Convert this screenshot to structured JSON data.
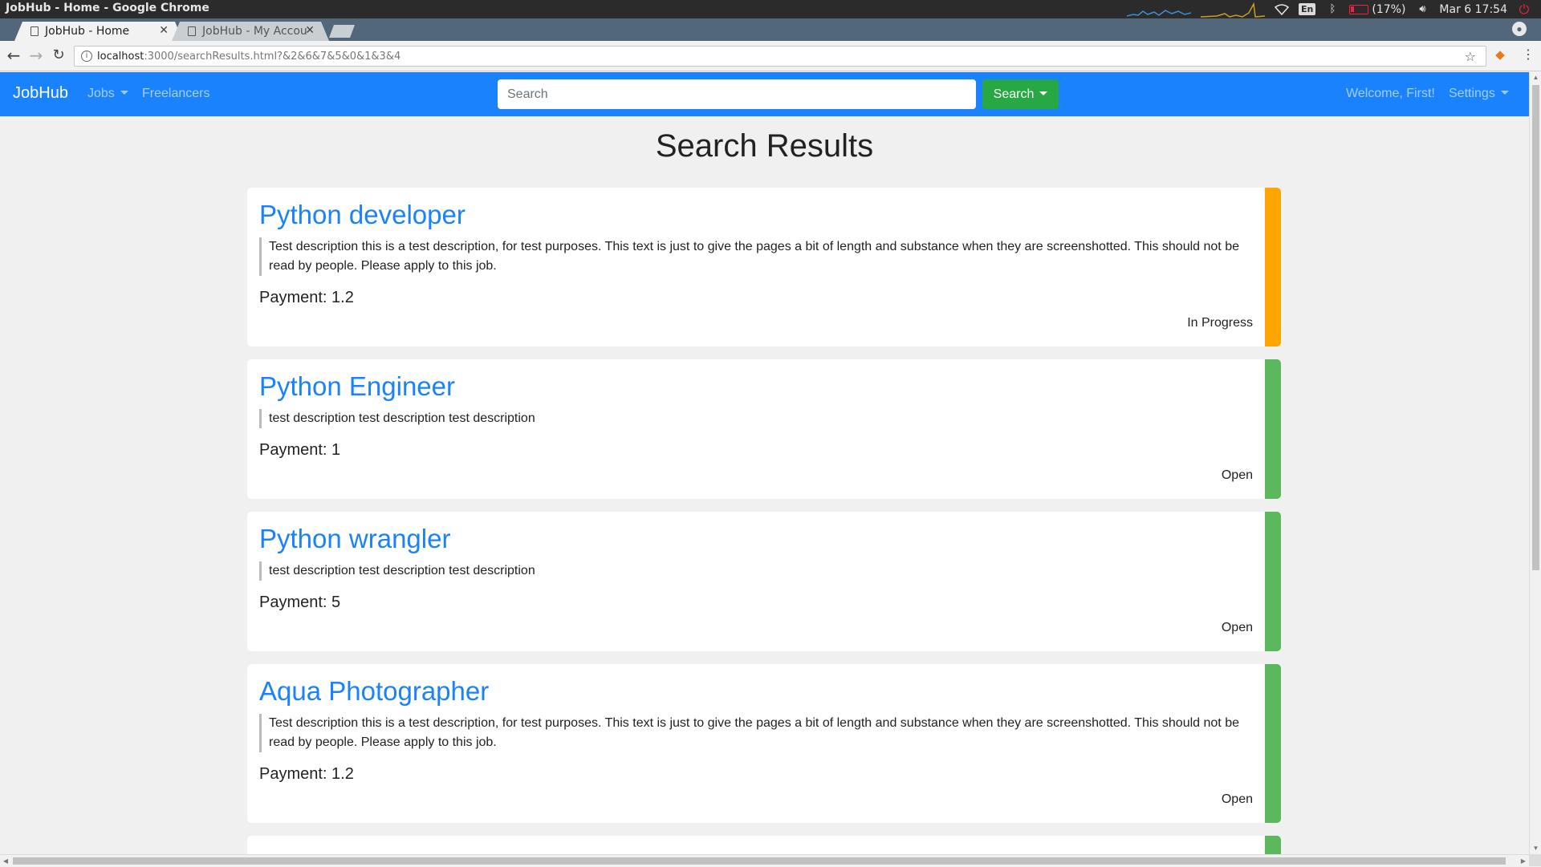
{
  "os": {
    "window_title": "JobHub - Home - Google Chrome",
    "keyboard_layout": "En",
    "battery": "(17%)",
    "datetime": "Mar 6 17:54"
  },
  "browser": {
    "tabs": [
      {
        "label": "JobHub - Home",
        "active": true
      },
      {
        "label": "JobHub - My Accou",
        "active": false
      }
    ],
    "url_host": "localhost",
    "url_path": ":3000/searchResults.html?&2&6&7&5&0&1&3&4"
  },
  "navbar": {
    "brand": "JobHub",
    "jobs_label": "Jobs",
    "freelancers_label": "Freelancers",
    "search_placeholder": "Search",
    "search_button_label": "Search",
    "welcome_text": "Welcome, First!",
    "settings_label": "Settings",
    "bg_color": "#1a82fc"
  },
  "page": {
    "title": "Search Results"
  },
  "jobs": [
    {
      "title": "Python developer",
      "description": "Test description this is a test description, for test purposes. This text is just to give the pages a bit of length and substance when they are screenshotted. This should not be read by people. Please apply to this job.",
      "payment": "Payment: 1.2",
      "status": "In Progress",
      "status_color": "#ffa500"
    },
    {
      "title": "Python Engineer",
      "description": "test description test description test description",
      "payment": "Payment: 1",
      "status": "Open",
      "status_color": "#5cb85c"
    },
    {
      "title": "Python wrangler",
      "description": "test description test description test description",
      "payment": "Payment: 5",
      "status": "Open",
      "status_color": "#5cb85c"
    },
    {
      "title": "Aqua Photographer",
      "description": "Test description this is a test description, for test purposes. This text is just to give the pages a bit of length and substance when they are screenshotted. This should not be read by people. Please apply to this job.",
      "payment": "Payment: 1.2",
      "status": "Open",
      "status_color": "#5cb85c"
    },
    {
      "status_color": "#5cb85c"
    }
  ]
}
